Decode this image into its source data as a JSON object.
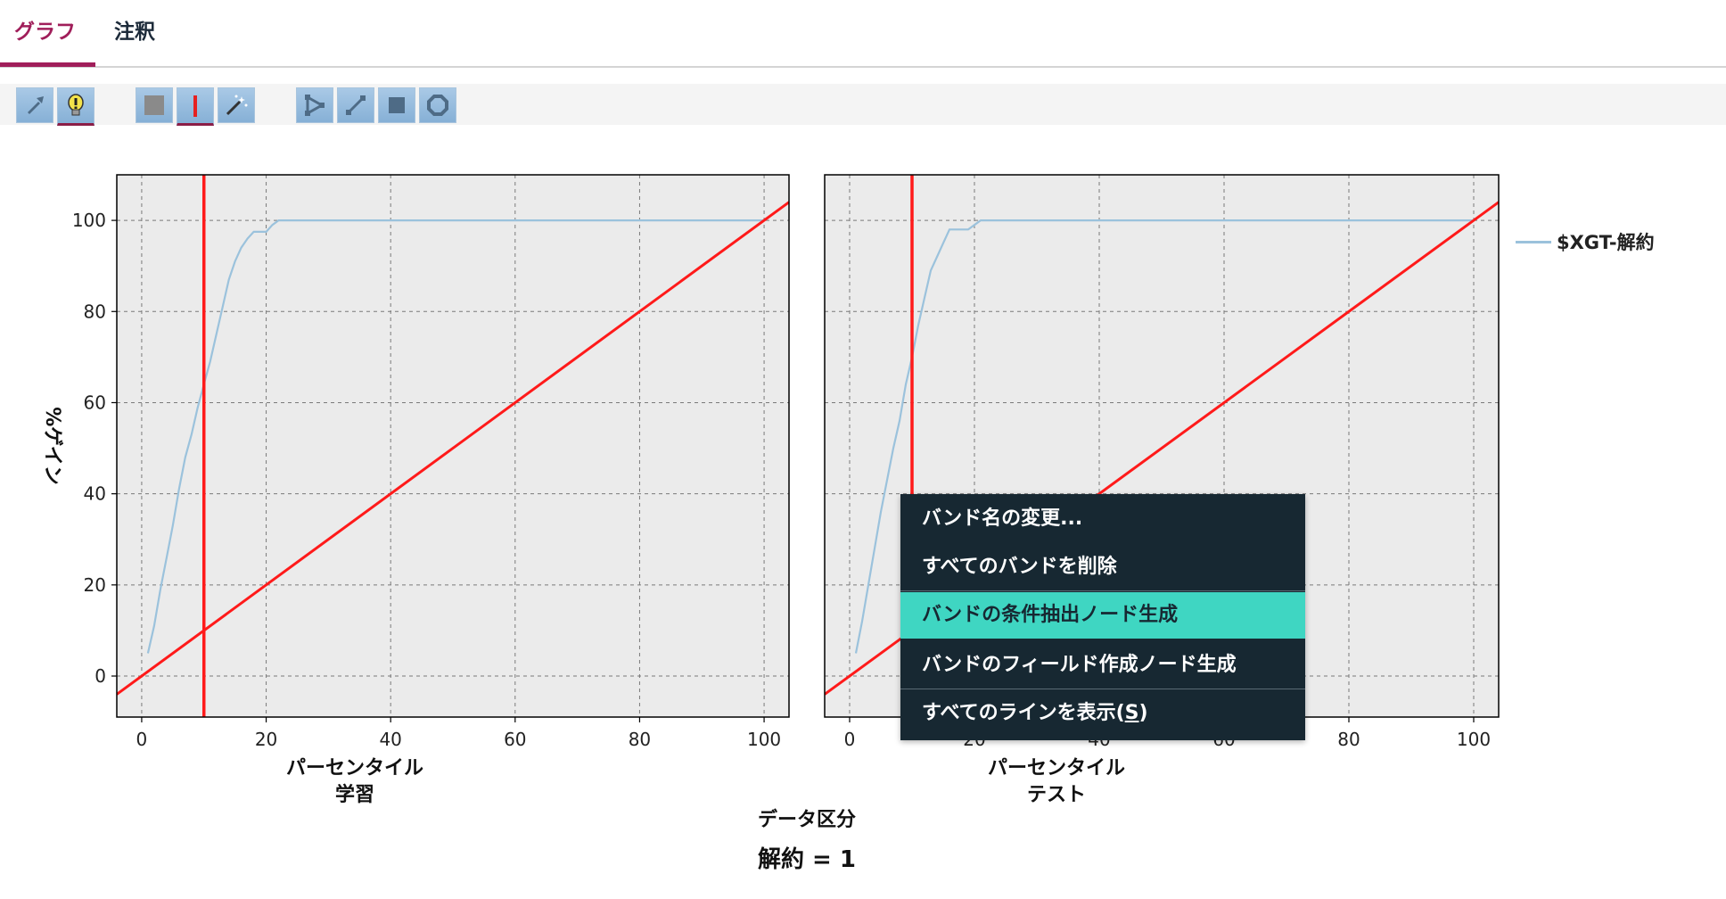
{
  "tabs": [
    {
      "label": "グラフ",
      "active": true
    },
    {
      "label": "注釈",
      "active": false
    }
  ],
  "toolbar": {
    "buttons": [
      {
        "icon": "pointer-icon",
        "selected": false
      },
      {
        "icon": "lightbulb-icon",
        "selected": true
      },
      {
        "icon": "band-region-icon",
        "selected": false
      },
      {
        "icon": "vertical-line-icon",
        "selected": true
      },
      {
        "icon": "magic-wand-icon",
        "selected": false
      },
      {
        "icon": "polygon-select-icon",
        "selected": false
      },
      {
        "icon": "line-draw-icon",
        "selected": false
      },
      {
        "icon": "rectangle-draw-icon",
        "selected": false
      },
      {
        "icon": "octagon-draw-icon",
        "selected": false
      }
    ]
  },
  "chart_data": {
    "type": "line",
    "ylabel": "%ゲイン",
    "facet_axis_label": "データ区分",
    "footer_title": "解約 = 1",
    "xlim": [
      -4,
      104
    ],
    "ylim": [
      -9,
      110
    ],
    "xticks": [
      0,
      20,
      40,
      60,
      80,
      100
    ],
    "yticks": [
      0,
      20,
      40,
      60,
      80,
      100
    ],
    "grid": true,
    "legend": {
      "position": "right",
      "entries": [
        {
          "name": "$XGT-解約",
          "color": "#9bc2dc"
        }
      ]
    },
    "band_line_x": 10,
    "band_line_color": "#ff1a1a",
    "panels": [
      {
        "xlabel": "パーセンタイル",
        "facet_label": "学習",
        "series": [
          {
            "name": "$XGT-解約",
            "color": "#9bc2dc",
            "x": [
              1,
              2,
              3,
              4,
              5,
              6,
              7,
              8,
              9,
              10,
              11,
              12,
              13,
              14,
              15,
              16,
              17,
              18,
              19,
              20,
              21,
              22,
              25,
              30,
              40,
              50,
              60,
              70,
              80,
              90,
              100
            ],
            "y": [
              5,
              11,
              19,
              26,
              33,
              41,
              48,
              53,
              59,
              64,
              69,
              75,
              81,
              87,
              91,
              94,
              96,
              97.5,
              97.5,
              97.5,
              99,
              100,
              100,
              100,
              100,
              100,
              100,
              100,
              100,
              100,
              100
            ]
          }
        ]
      },
      {
        "xlabel": "パーセンタイル",
        "facet_label": "テスト",
        "series": [
          {
            "name": "$XGT-解約",
            "color": "#9bc2dc",
            "x": [
              1,
              2,
              3,
              4,
              5,
              6,
              7,
              8,
              9,
              10,
              11,
              12,
              13,
              14,
              15,
              16,
              17,
              18,
              19,
              20,
              21,
              22,
              25,
              30,
              40,
              50,
              60,
              70,
              80,
              90,
              100
            ],
            "y": [
              5,
              12,
              20,
              28,
              36,
              43,
              50,
              56,
              64,
              70,
              77,
              83,
              89,
              92,
              95,
              98,
              98,
              98,
              98,
              99,
              100,
              100,
              100,
              100,
              100,
              100,
              100,
              100,
              100,
              100,
              100
            ]
          }
        ]
      }
    ],
    "baseline": {
      "x": [
        -4,
        104
      ],
      "y": [
        -4,
        104
      ],
      "color": "#ff1a1a"
    }
  },
  "context_menu": {
    "items": [
      {
        "label": "バンド名の変更...",
        "highlight": false
      },
      {
        "label": "すべてのバンドを削除",
        "highlight": false
      },
      {
        "label": "バンドの条件抽出ノード生成",
        "highlight": true
      },
      {
        "label": "バンドのフィールド作成ノード生成",
        "highlight": false
      },
      {
        "label_prefix": "すべてのラインを表示(",
        "label_mnemonic": "S",
        "label_suffix": ")",
        "highlight": false
      }
    ]
  }
}
